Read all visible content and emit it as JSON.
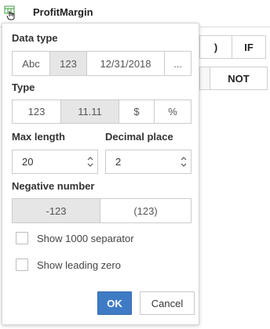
{
  "header": {
    "title": "ProfitMargin",
    "icon": "table-field-icon"
  },
  "background": {
    "buttons": [
      ")",
      "IF",
      "NOT"
    ]
  },
  "popup": {
    "data_type": {
      "label": "Data type",
      "options": [
        "Abc",
        "123",
        "12/31/2018",
        "..."
      ],
      "selected": "123"
    },
    "type": {
      "label": "Type",
      "options": [
        "123",
        "11.11",
        "$",
        "%"
      ],
      "selected": "11.11"
    },
    "max_length": {
      "label": "Max length",
      "value": "20"
    },
    "decimal_place": {
      "label": "Decimal place",
      "value": "2"
    },
    "negative_number": {
      "label": "Negative number",
      "options": [
        "-123",
        "(123)"
      ],
      "selected": "-123"
    },
    "show_1000_separator": {
      "label": "Show 1000 separator",
      "checked": false
    },
    "show_leading_zero": {
      "label": "Show leading zero",
      "checked": false
    },
    "ok_label": "OK",
    "cancel_label": "Cancel"
  },
  "colors": {
    "primary": "#3f7bc5",
    "active_segment": "#e6e6e6",
    "border": "#cccccc"
  }
}
